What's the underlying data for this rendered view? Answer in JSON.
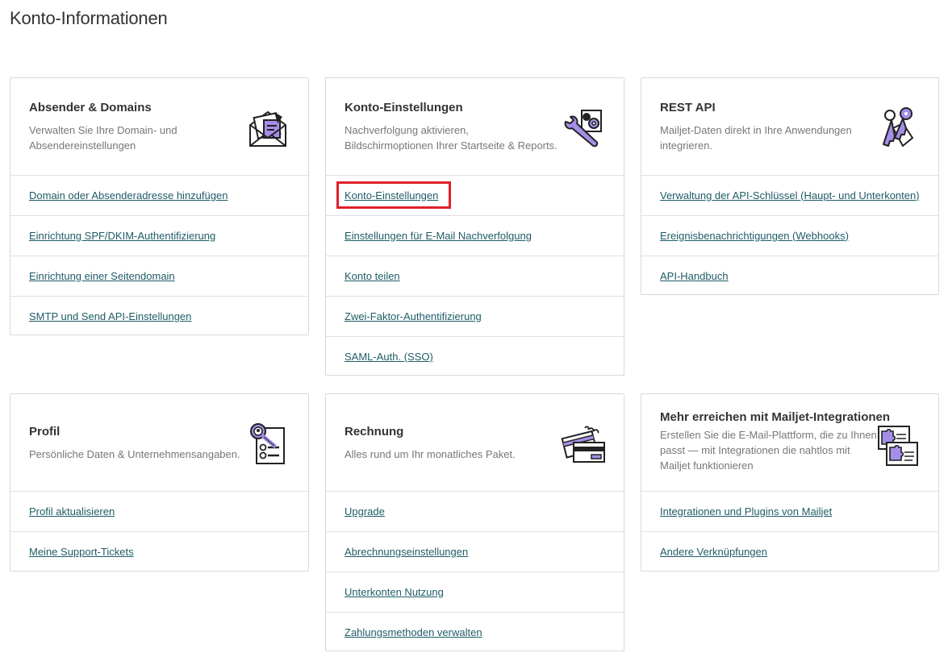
{
  "page": {
    "title": "Konto-Informationen"
  },
  "cards": {
    "senders": {
      "title": "Absender & Domains",
      "desc_line1": "Verwalten Sie Ihre Domain- und",
      "desc_line2": "Absendereinstellungen",
      "icon": "envelope-icon",
      "links": [
        "Domain oder Absenderadresse hinzufügen",
        "Einrichtung SPF/DKIM-Authentifizierung",
        "Einrichtung einer Seitendomain",
        "SMTP und Send API-Einstellungen"
      ]
    },
    "account": {
      "title": "Konto-Einstellungen",
      "desc_line1": "Nachverfolgung aktivieren,",
      "desc_line2": "Bildschirmoptionen Ihrer Startseite & Reports.",
      "icon": "wrench-gear-icon",
      "links": [
        "Konto-Einstellungen",
        "Einstellungen für E-Mail Nachverfolgung",
        "Konto teilen",
        "Zwei-Faktor-Authentifizierung",
        "SAML-Auth. (SSO)"
      ]
    },
    "api": {
      "title": "REST API",
      "desc_line1": "Mailjet-Daten direkt in Ihre Anwendungen",
      "desc_line2": "integrieren.",
      "icon": "keys-icon",
      "links": [
        "Verwaltung der API-Schlüssel (Haupt- und Unterkonten)",
        "Ereignisbenachrichtigungen (Webhooks)",
        "API-Handbuch"
      ]
    },
    "profile": {
      "title": "Profil",
      "desc_line1": "Persönliche Daten & Unternehmensangaben.",
      "icon": "profile-document-icon",
      "links": [
        "Profil aktualisieren",
        "Meine Support-Tickets"
      ]
    },
    "billing": {
      "title": "Rechnung",
      "desc_line1": "Alles rund um Ihr monatliches Paket.",
      "icon": "credit-card-icon",
      "links": [
        "Upgrade",
        "Abrechnungseinstellungen",
        "Unterkonten Nutzung",
        "Zahlungsmethoden verwalten"
      ]
    },
    "integrations": {
      "title": "Mehr erreichen mit Mailjet-Integrationen",
      "desc_line1": "Erstellen Sie die E-Mail-Plattform, die zu Ihnen",
      "desc_line2": "passt — mit Integrationen die nahtlos mit",
      "desc_line3": "Mailjet funktionieren",
      "icon": "puzzle-icon",
      "links": [
        "Integrationen und Plugins von Mailjet",
        "Andere Verknüpfungen"
      ]
    }
  },
  "colors": {
    "link": "#1e5c67",
    "accent_purple": "#a48ee8",
    "highlight": "#e0202b",
    "border": "#d9d9d9"
  }
}
